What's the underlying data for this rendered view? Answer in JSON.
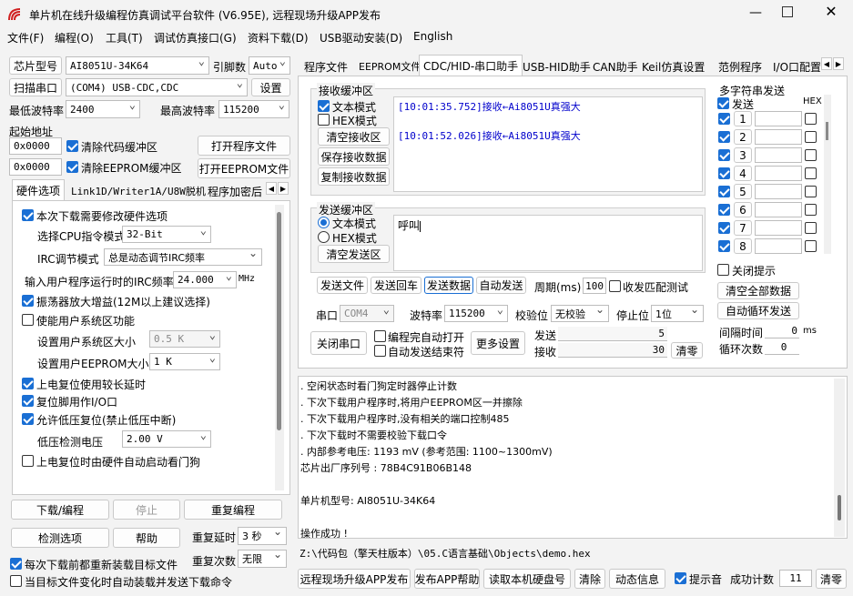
{
  "window": {
    "title": "单片机在线升级编程仿真调试平台软件 (V6.95E), 远程现场升级APP发布"
  },
  "menu": [
    "文件(F)",
    "编程(O)",
    "工具(T)",
    "调试仿真接口(G)",
    "资料下载(D)",
    "USB驱动安装(D)",
    "English"
  ],
  "left": {
    "chip_label": "芯片型号",
    "chip_value": "AI8051U-34K64",
    "pins_label": "引脚数",
    "pins_value": "Auto",
    "scan_label": "扫描串口",
    "port_value": "(COM4) USB-CDC,CDC",
    "settings_label": "设置",
    "min_baud_label": "最低波特率",
    "min_baud_value": "2400",
    "max_baud_label": "最高波特率",
    "max_baud_value": "115200",
    "start_addr_label": "起始地址",
    "addr1": "0x0000",
    "clear_code_label": "清除代码缓冲区",
    "open_prog_label": "打开程序文件",
    "addr2": "0x0000",
    "clear_eeprom_label": "清除EEPROM缓冲区",
    "open_eeprom_label": "打开EEPROM文件",
    "tabs": [
      "硬件选项",
      "Link1D/Writer1A/U8W脱机",
      "程序加密后"
    ],
    "hw": {
      "modify_hw": "本次下载需要修改硬件选项",
      "cpu_label": "选择CPU指令模式",
      "cpu_value": "32-Bit",
      "irc_label": "IRC调节模式",
      "irc_value": "总是动态调节IRC频率",
      "freq_label": "输入用户程序运行时的IRC频率",
      "freq_value": "24.000",
      "freq_unit": "MHz",
      "osc_gain": "振荡器放大增益(12M以上建议选择)",
      "user_sys": "使能用户系统区功能",
      "user_sys_size_label": "设置用户系统区大小",
      "user_sys_size_value": "0.5 K",
      "eeprom_size_label": "设置用户EEPROM大小",
      "eeprom_size_value": "1   K",
      "power_delay": "上电复位使用较长延时",
      "reset_io": "复位脚用作I/O口",
      "low_volt_reset": "允许低压复位(禁止低压中断)",
      "low_volt_label": "低压检测电压",
      "low_volt_value": "2.00 V",
      "wdt": "上电复位时由硬件自动启动看门狗"
    },
    "download_label": "下载/编程",
    "stop_label": "停止",
    "reprogram_label": "重复编程",
    "detect_label": "检测选项",
    "help_label": "帮助",
    "repeat_delay_label": "重复延时",
    "repeat_delay_value": "3 秒",
    "reload_label": "每次下载前都重新装载目标文件",
    "repeat_count_label": "重复次数",
    "repeat_count_value": "无限",
    "auto_label": "当目标文件变化时自动装载并发送下载命令"
  },
  "right_tabs": [
    "程序文件",
    "EEPROM文件",
    "CDC/HID-串口助手",
    "USB-HID助手",
    "CAN助手",
    "Keil仿真设置",
    "范例程序",
    "I/O口配置"
  ],
  "serial": {
    "recv_group": "接收缓冲区",
    "text_mode": "文本模式",
    "hex_mode": "HEX模式",
    "clear_recv": "清空接收区",
    "save_recv": "保存接收数据",
    "copy_recv": "复制接收数据",
    "recv_lines": [
      "[10:01:35.752]接收←Ai8051U真强大",
      "[10:01:52.026]接收←Ai8051U真强大"
    ],
    "send_group": "发送缓冲区",
    "send_text": "呼叫",
    "clear_send": "清空发送区",
    "send_file": "发送文件",
    "send_return": "发送回车",
    "send_data": "发送数据",
    "auto_send": "自动发送",
    "period_label": "周期(ms)",
    "period_value": "100",
    "recv_match": "收发匹配测试",
    "port_label": "串口",
    "port_value": "COM4",
    "baud_label": "波特率",
    "baud_value": "115200",
    "check_label": "校验位",
    "check_value": "无校验",
    "stop_label": "停止位",
    "stop_value": "1位",
    "close_port": "关闭串口",
    "auto_open": "编程完自动打开",
    "auto_send_end": "自动发送结束符",
    "more_settings": "更多设置",
    "send_count_label": "发送",
    "send_count": "5",
    "recv_count_label": "接收",
    "recv_count": "30",
    "clear_count": "清零"
  },
  "multi": {
    "title": "多字符串发送",
    "send_label": "发送",
    "hex_label": "HEX",
    "rows": [
      "1",
      "2",
      "3",
      "4",
      "5",
      "6",
      "7",
      "8"
    ],
    "close_hint": "关闭提示",
    "clear_all": "清空全部数据",
    "auto_loop": "自动循环发送",
    "interval_label": "间隔时间",
    "interval_value": "0",
    "interval_unit": "ms",
    "loop_label": "循环次数",
    "loop_value": "0"
  },
  "log": [
    ". 空闲状态时看门狗定时器停止计数",
    ". 下次下载用户程序时,将用户EEPROM区一并擦除",
    ". 下次下载用户程序时,没有相关的端口控制485",
    ". 下次下载时不需要校验下载口令",
    ". 内部参考电压: 1193 mV (参考范围: 1100~1300mV)",
    "芯片出厂序列号 : 78B4C91B06B148",
    "",
    " 单片机型号: AI8051U-34K64",
    "",
    "操作成功 !"
  ],
  "path": "Z:\\代码包（擎天柱版本）\\05.C语言基础\\Objects\\demo.hex",
  "bottom": {
    "remote_upgrade": "远程现场升级APP发布",
    "publish_help": "发布APP帮助",
    "read_disk": "读取本机硬盘号",
    "clear": "清除",
    "anim": "动态信息",
    "beep": "提示音",
    "success_label": "成功计数",
    "success_value": "11",
    "reset": "清零"
  },
  "colors": {
    "accent": "#1a6fd4",
    "recv_text": "#0000cc"
  }
}
